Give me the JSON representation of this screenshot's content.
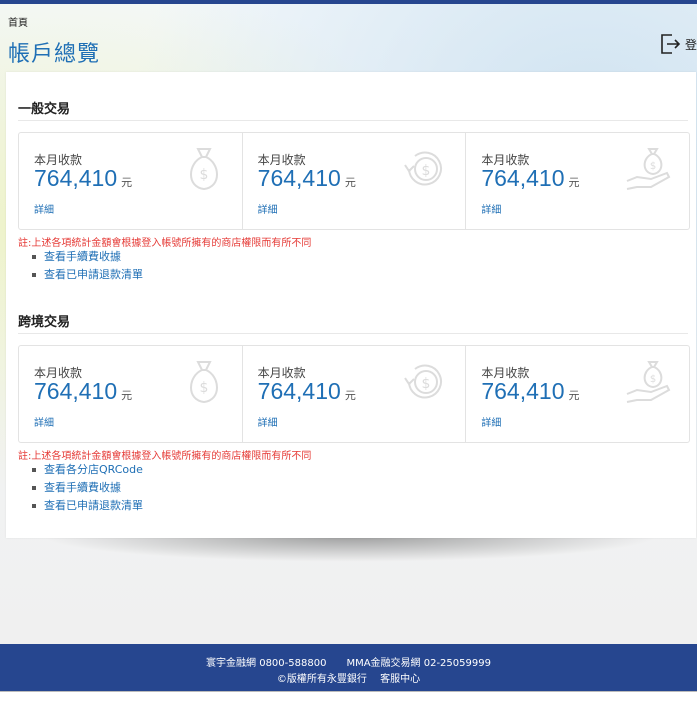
{
  "breadcrumb": "首頁",
  "page_title": "帳戶總覽",
  "logout_label": "登",
  "sections": [
    {
      "title": "一般交易",
      "stats": [
        {
          "label": "本月收款",
          "amount": "764,410",
          "unit": "元",
          "detail": "詳細",
          "icon": "money-bag-icon"
        },
        {
          "label": "本月收款",
          "amount": "764,410",
          "unit": "元",
          "detail": "詳細",
          "icon": "refund-dollar-icon"
        },
        {
          "label": "本月收款",
          "amount": "764,410",
          "unit": "元",
          "detail": "詳細",
          "icon": "hand-money-icon"
        }
      ],
      "note": "註:上述各項統計金額會根據登入帳號所擁有的商店權限而有所不同",
      "links": [
        "查看手續費收據",
        "查看已申請退款清單"
      ]
    },
    {
      "title": "跨境交易",
      "stats": [
        {
          "label": "本月收款",
          "amount": "764,410",
          "unit": "元",
          "detail": "詳細",
          "icon": "money-bag-icon"
        },
        {
          "label": "本月收款",
          "amount": "764,410",
          "unit": "元",
          "detail": "詳細",
          "icon": "refund-dollar-icon"
        },
        {
          "label": "本月收款",
          "amount": "764,410",
          "unit": "元",
          "detail": "詳細",
          "icon": "hand-money-icon"
        }
      ],
      "note": "註:上述各項統計金額會根據登入帳號所擁有的商店權限而有所不同",
      "links": [
        "查看各分店QRCode",
        "查看手續費收據",
        "查看已申請退款清單"
      ]
    }
  ],
  "footer": {
    "line1": "寰宇金融網 0800-588800　　MMA金融交易網 02-25059999",
    "line2": "©版權所有永豐銀行　 客服中心"
  }
}
